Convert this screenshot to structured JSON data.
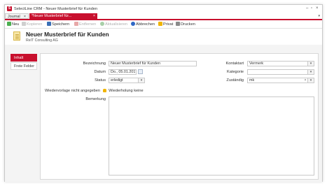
{
  "window": {
    "title": "SelectLine CRM - Neuer Musterbrief für Kunden",
    "app_icon_letter": "S",
    "controls": [
      "–",
      "▫",
      "×"
    ]
  },
  "tabs": [
    {
      "label": "Journal",
      "close": "×"
    },
    {
      "label": "*Neuer Musterbrief für...",
      "close": "×"
    }
  ],
  "tab_dropdown": "▾",
  "toolbar": {
    "neu": "Neu",
    "kopieren": "Kopieren",
    "speichern": "Speichern",
    "entfernen": "Entfernen",
    "aktualisieren": "Aktualisieren",
    "abbrechen": "Abbrechen",
    "privat": "Privat",
    "drucken": "Drucken"
  },
  "header": {
    "title": "Neuer Musterbrief für Kunden",
    "subtitle": "ReIT Consulting AG"
  },
  "sidebar": {
    "items": [
      {
        "label": "Inhalt"
      },
      {
        "label": "Freie Felder"
      }
    ]
  },
  "form": {
    "bezeichnung": {
      "label": "Bezeichnung",
      "value": "Neuer Musterbrief für Kunden"
    },
    "datum": {
      "label": "Datum",
      "value": "Do., 05.01.2017"
    },
    "status": {
      "label": "Status",
      "value": "erledigt"
    },
    "kontaktart": {
      "label": "Kontaktart",
      "value": "Vermerk"
    },
    "kategorie": {
      "label": "Kategorie",
      "value": ""
    },
    "zustaendig": {
      "label": "Zuständig",
      "value": "mk",
      "clear": "×"
    },
    "wiedervorlage": {
      "label": "Wiedervorlage",
      "value": "nicht angegeben",
      "wiederholung": "Wiederholung keine"
    },
    "bemerkung": {
      "label": "Bemerkung",
      "value": ""
    }
  },
  "colors": {
    "accent": "#c8102e",
    "bell": "#f0b400"
  }
}
